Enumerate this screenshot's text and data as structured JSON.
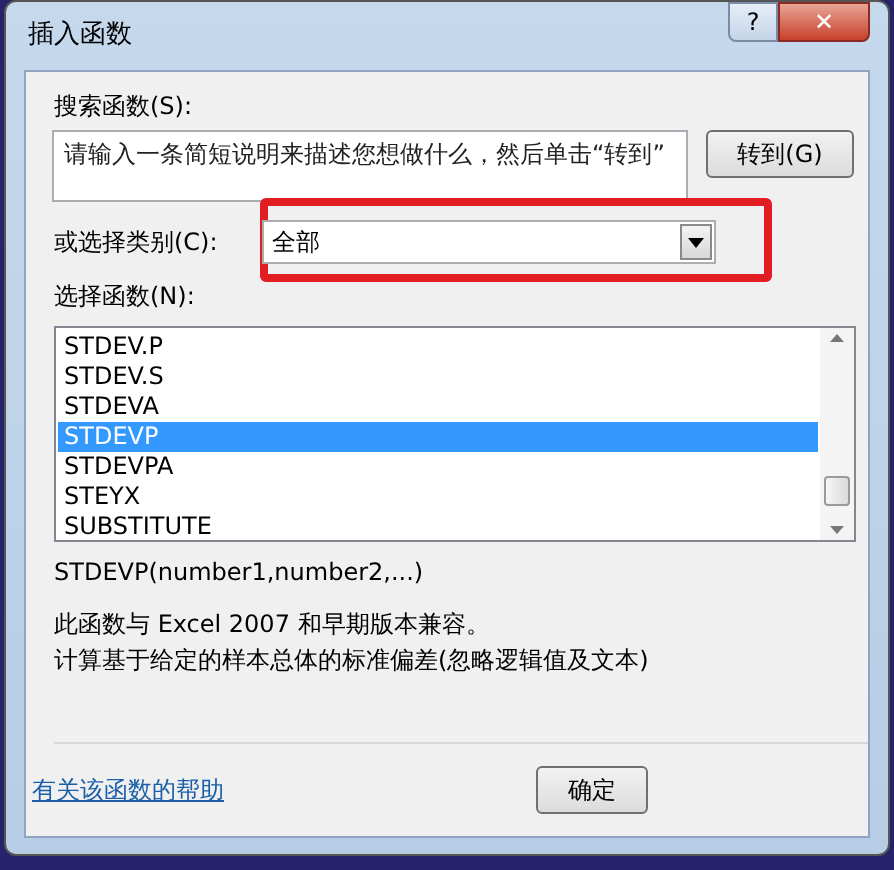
{
  "window": {
    "title": "插入函数",
    "help_button": "?",
    "close_button": "✕"
  },
  "search": {
    "label": "搜索函数(S):",
    "placeholder": "请输入一条简短说明来描述您想做什么，然后单击“转到”",
    "go_button": "转到(G)"
  },
  "category": {
    "label": "或选择类别(C):",
    "value": "全部",
    "highlighted": true
  },
  "functions": {
    "label": "选择函数(N):",
    "items": [
      {
        "name": "STDEV.P",
        "selected": false
      },
      {
        "name": "STDEV.S",
        "selected": false
      },
      {
        "name": "STDEVA",
        "selected": false
      },
      {
        "name": "STDEVP",
        "selected": true
      },
      {
        "name": "STDEVPA",
        "selected": false
      },
      {
        "name": "STEYX",
        "selected": false
      },
      {
        "name": "SUBSTITUTE",
        "selected": false
      }
    ]
  },
  "signature": "STDEVP(number1,number2,...)",
  "description": [
    "此函数与 Excel 2007 和早期版本兼容。",
    "计算基于给定的样本总体的标准偏差(忽略逻辑值及文本)"
  ],
  "help_link": "有关该函数的帮助",
  "ok_button": "确定"
}
